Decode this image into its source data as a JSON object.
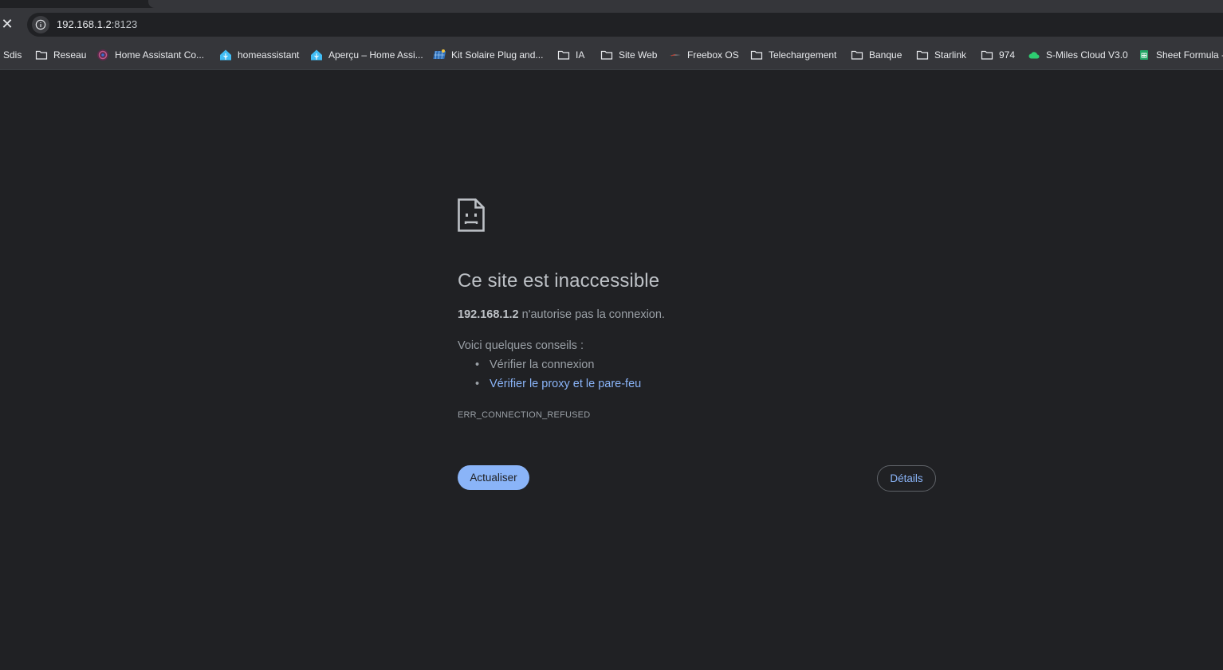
{
  "toolbar": {
    "url_host": "192.168.1.2",
    "url_port": ":8123"
  },
  "bookmarks": [
    {
      "label": "Sdis",
      "icon": "none"
    },
    {
      "label": "Reseau",
      "icon": "folder-icon"
    },
    {
      "label": "Home Assistant Co...",
      "icon": "home-assistant-community-icon"
    },
    {
      "label": "homeassistant",
      "icon": "home-assistant-icon"
    },
    {
      "label": "Aperçu – Home Assi...",
      "icon": "home-assistant-icon"
    },
    {
      "label": "Kit Solaire Plug and...",
      "icon": "solar-panel-icon"
    },
    {
      "label": "IA",
      "icon": "folder-icon"
    },
    {
      "label": "Site Web",
      "icon": "folder-icon"
    },
    {
      "label": "Freebox OS",
      "icon": "freebox-icon"
    },
    {
      "label": "Telechargement",
      "icon": "folder-icon"
    },
    {
      "label": "Banque",
      "icon": "folder-icon"
    },
    {
      "label": "Starlink",
      "icon": "folder-icon"
    },
    {
      "label": "974",
      "icon": "folder-icon"
    },
    {
      "label": "S-Miles Cloud V3.0",
      "icon": "cloud-icon"
    },
    {
      "label": "Sheet Formula -",
      "icon": "sheets-icon"
    }
  ],
  "error": {
    "title": "Ce site est inaccessible",
    "host": "192.168.1.2",
    "description": " n'autorise pas la connexion.",
    "tips_label": "Voici quelques conseils :",
    "tips": [
      "Vérifier la connexion",
      "Vérifier le proxy et le pare-feu"
    ],
    "code": "ERR_CONNECTION_REFUSED"
  },
  "buttons": {
    "reload": "Actualiser",
    "details": "Détails"
  },
  "colors": {
    "background": "#202124",
    "toolbar": "#35363a",
    "link": "#8ab4f8",
    "text": "#9aa0a6"
  }
}
